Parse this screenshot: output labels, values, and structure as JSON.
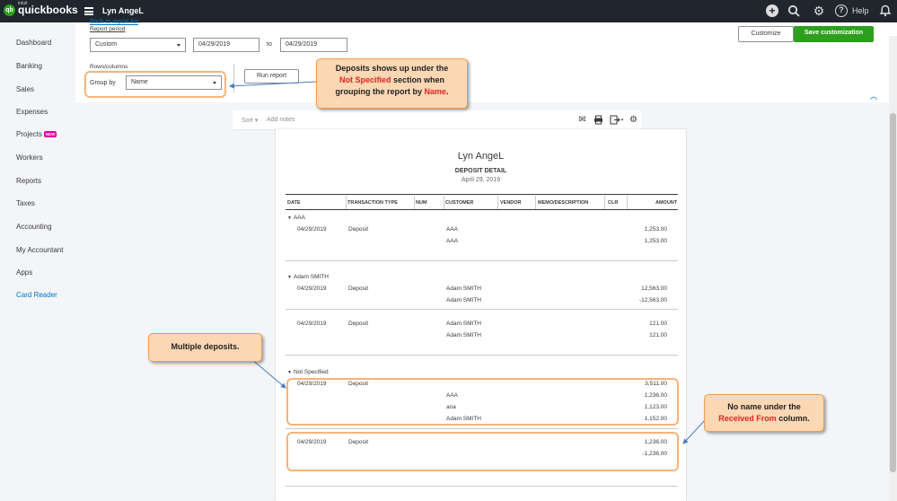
{
  "topbar": {
    "brand_prefix": "intuit",
    "brand": "quickbooks",
    "company": "Lyn AngeL",
    "help_label": "Help",
    "icons": [
      "plus-icon",
      "search-icon",
      "gear-icon",
      "help-icon",
      "bell-icon"
    ]
  },
  "sidebar": {
    "items": [
      {
        "label": "Dashboard"
      },
      {
        "label": "Banking"
      },
      {
        "label": "Sales"
      },
      {
        "label": "Expenses"
      },
      {
        "label": "Projects",
        "badge": "NEW"
      },
      {
        "label": "Workers"
      },
      {
        "label": "Reports"
      },
      {
        "label": "Taxes"
      },
      {
        "label": "Accounting"
      },
      {
        "label": "My Accountant"
      },
      {
        "label": "Apps"
      },
      {
        "label": "Card Reader"
      }
    ]
  },
  "controls": {
    "back_link": "Back to report list",
    "report_period_label": "Report period",
    "period_value": "Custom",
    "from_date": "04/29/2019",
    "to_label": "to",
    "to_date": "04/29/2019",
    "rows_columns_label": "Rows/columns",
    "group_by_label": "Group by",
    "group_by_value": "Name",
    "run_report": "Run report",
    "customize": "Customize",
    "save_customization": "Save customization"
  },
  "report_toolbar": {
    "sort": "Sort",
    "add_notes": "Add notes",
    "icons": [
      "email-icon",
      "print-icon",
      "export-icon",
      "gear-icon"
    ]
  },
  "report": {
    "company": "Lyn AngeL",
    "title": "DEPOSIT DETAIL",
    "date": "April 29, 2019",
    "columns": [
      "DATE",
      "TRANSACTION TYPE",
      "NUM",
      "CUSTOMER",
      "VENDOR",
      "MEMO/DESCRIPTION",
      "CLR",
      "AMOUNT"
    ],
    "groups": {
      "aaa": {
        "name": "AAA",
        "row1": {
          "date": "04/29/2019",
          "type": "Deposit",
          "customer": "AAA",
          "amount": "1,253.00"
        },
        "row2": {
          "customer": "AAA",
          "amount": "1,253.00"
        }
      },
      "adam": {
        "name": "Adam SMITH",
        "d1": {
          "date": "04/29/2019",
          "type": "Deposit",
          "customer": "Adam SMITH",
          "amount": "12,563.00"
        },
        "d1b": {
          "customer": "Adam SMITH",
          "amount": "-12,563.00"
        },
        "d2": {
          "date": "04/29/2019",
          "type": "Deposit",
          "customer": "Adam SMITH",
          "amount": "121.00"
        },
        "d2b": {
          "customer": "Adam SMITH",
          "amount": "121.00"
        }
      },
      "ns": {
        "name": "Not Specified",
        "d1": {
          "date": "04/29/2019",
          "type": "Deposit",
          "amount": "3,511.00"
        },
        "l1": {
          "customer": "AAA",
          "amount": "1,236.00"
        },
        "l2": {
          "customer": "ana",
          "amount": "1,123.00"
        },
        "l3": {
          "customer": "Adam SMITH",
          "amount": "1,152.00"
        },
        "d2": {
          "date": "04/29/2019",
          "type": "Deposit",
          "amount": "1,236.00"
        },
        "d2b": {
          "amount": "-1,236.00"
        }
      }
    }
  },
  "callouts": {
    "c1": {
      "line1": "Deposits shows up under the",
      "line2_red": "Not Specified",
      "line2_rest": " section when",
      "line3_pre": "grouping the report by ",
      "line3_red": "Name",
      "line3_post": "."
    },
    "c2": {
      "text": "Multiple deposits."
    },
    "c3": {
      "line1": "No name under the",
      "line2_red": "Received From",
      "line2_rest": " column."
    }
  },
  "colors": {
    "accent": "#2ca01c",
    "link": "#0077c5",
    "topbar": "#21262e",
    "highlight": "#f5b47c",
    "callout_fill": "#fbd7b4",
    "emphasis": "#e42521"
  }
}
